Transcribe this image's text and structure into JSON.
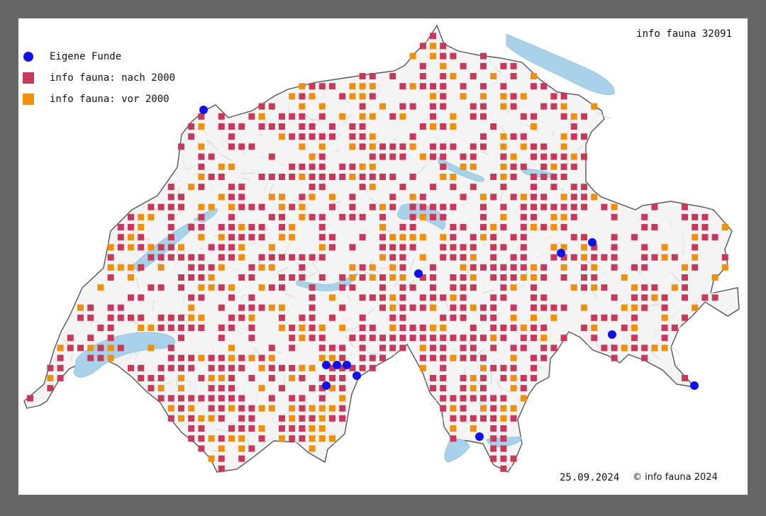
{
  "map_title": "info fauna 32091",
  "footer": {
    "date": "25.09.2024",
    "copyright": "© info fauna 2024"
  },
  "legend": [
    {
      "label": "Eigene Funde",
      "color": "#1010ee",
      "shape": "circle"
    },
    {
      "label": "info fauna: nach 2000",
      "color": "#c8385a",
      "shape": "square"
    },
    {
      "label": "info fauna: vor 2000",
      "color": "#f0900a",
      "shape": "square"
    }
  ],
  "colors": {
    "background": "#666666",
    "land": "#f4f4f4",
    "lake": "#a8d2ea",
    "border": "#555555",
    "own": "#1010ee",
    "after2000": "#c8385a",
    "before2000": "#f0900a"
  },
  "map_legend_note": "grid of occurrence squares over a shaded relief map of Switzerland"
}
